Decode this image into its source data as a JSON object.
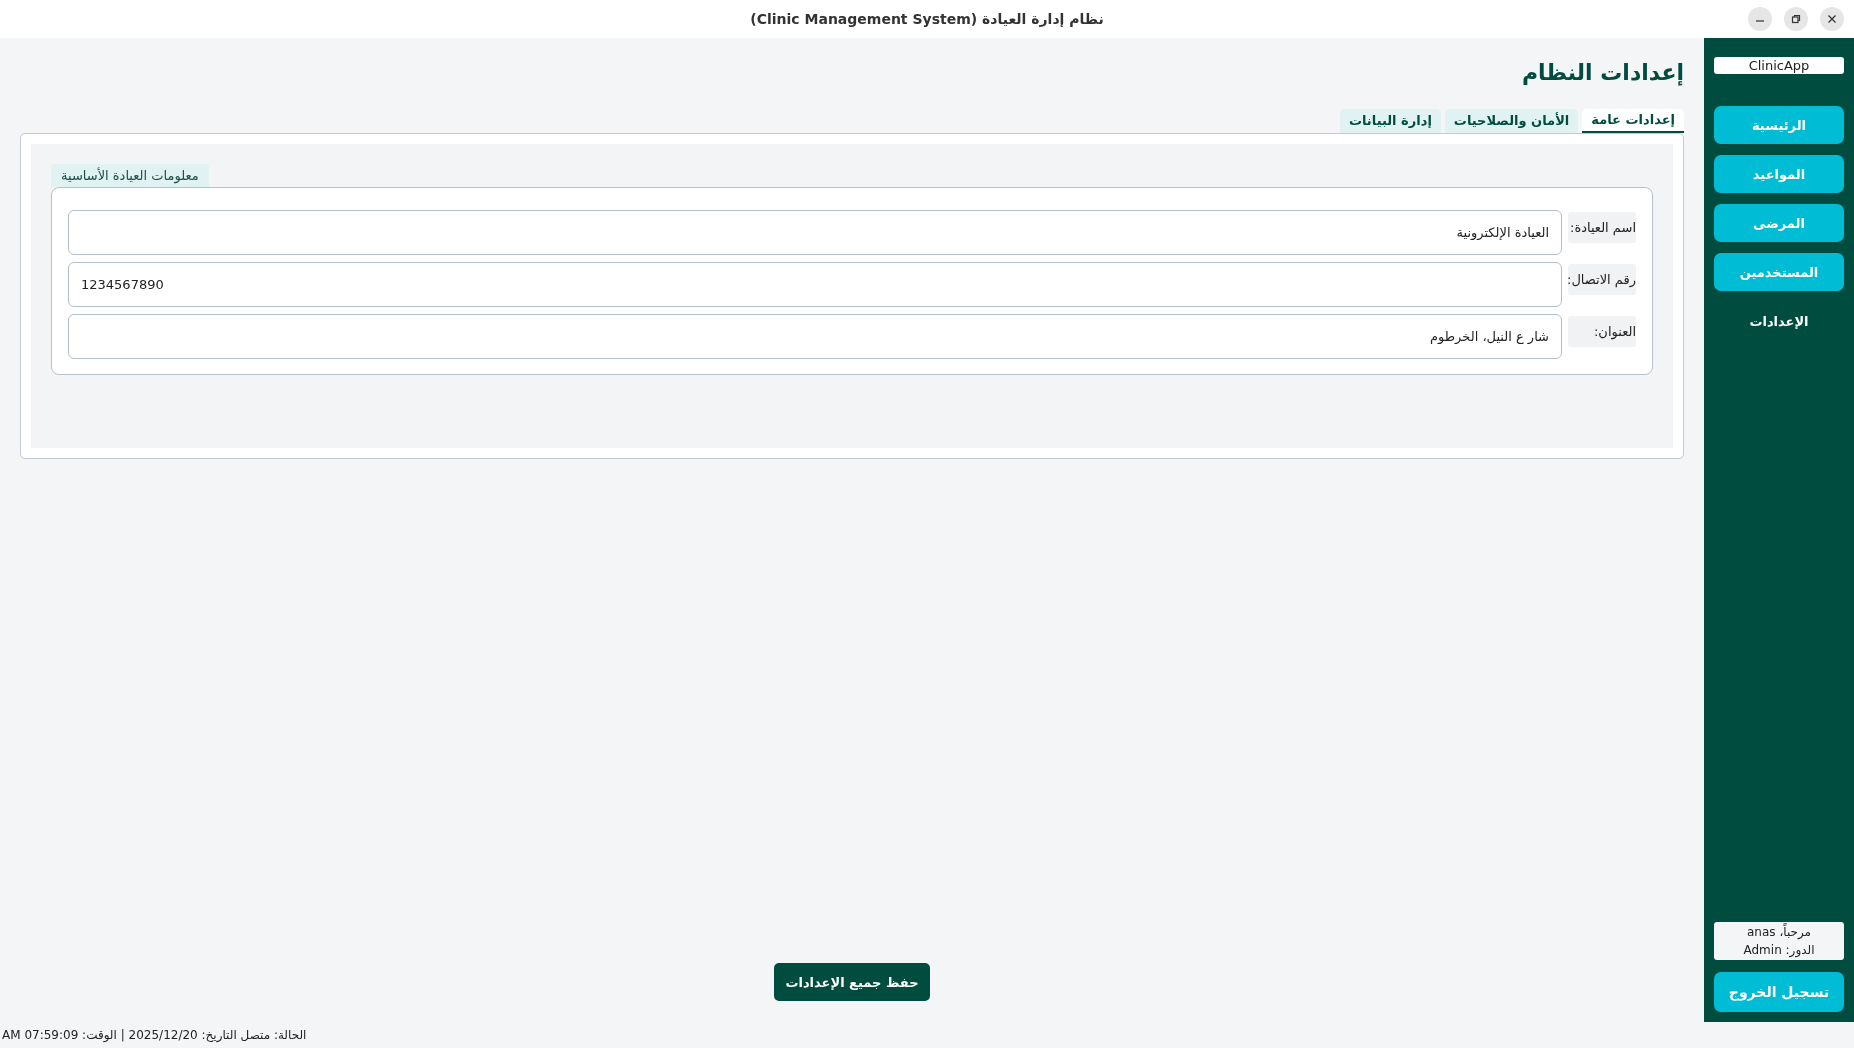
{
  "window": {
    "title": "نظام إدارة العيادة (Clinic Management System)"
  },
  "page": {
    "title": "إعدادات النظام"
  },
  "tabs": [
    {
      "label": "إعدادات عامة",
      "selected": true
    },
    {
      "label": "الأمان والصلاحيات",
      "selected": false
    },
    {
      "label": "إدارة البيانات",
      "selected": false
    }
  ],
  "group": {
    "title": "معلومات العيادة الأساسية",
    "fields": [
      {
        "label": "اسم العيادة:",
        "value": "العيادة الإلكترونية"
      },
      {
        "label": "رقم الاتصال:",
        "value": "1234567890"
      },
      {
        "label": "العنوان:",
        "value": "شار ع النيل، الخرطوم"
      }
    ]
  },
  "save_button": "حفظ جميع الإعدادات",
  "sidebar": {
    "logo": "ClinicApp",
    "items": [
      {
        "label": "الرئيسية",
        "selected": false
      },
      {
        "label": "المواعيد",
        "selected": false
      },
      {
        "label": "المرضى",
        "selected": false
      },
      {
        "label": "المستخدمين",
        "selected": false
      },
      {
        "label": "الإعدادات",
        "selected": true
      }
    ],
    "user": {
      "greeting": "مرحباً، anas",
      "role": "الدور: Admin"
    },
    "logout": "تسجيل الخروج"
  },
  "status_bar": "الحالة: متصل التاريخ: 2025/12/20 | الوقت: 07:59:09 AM"
}
